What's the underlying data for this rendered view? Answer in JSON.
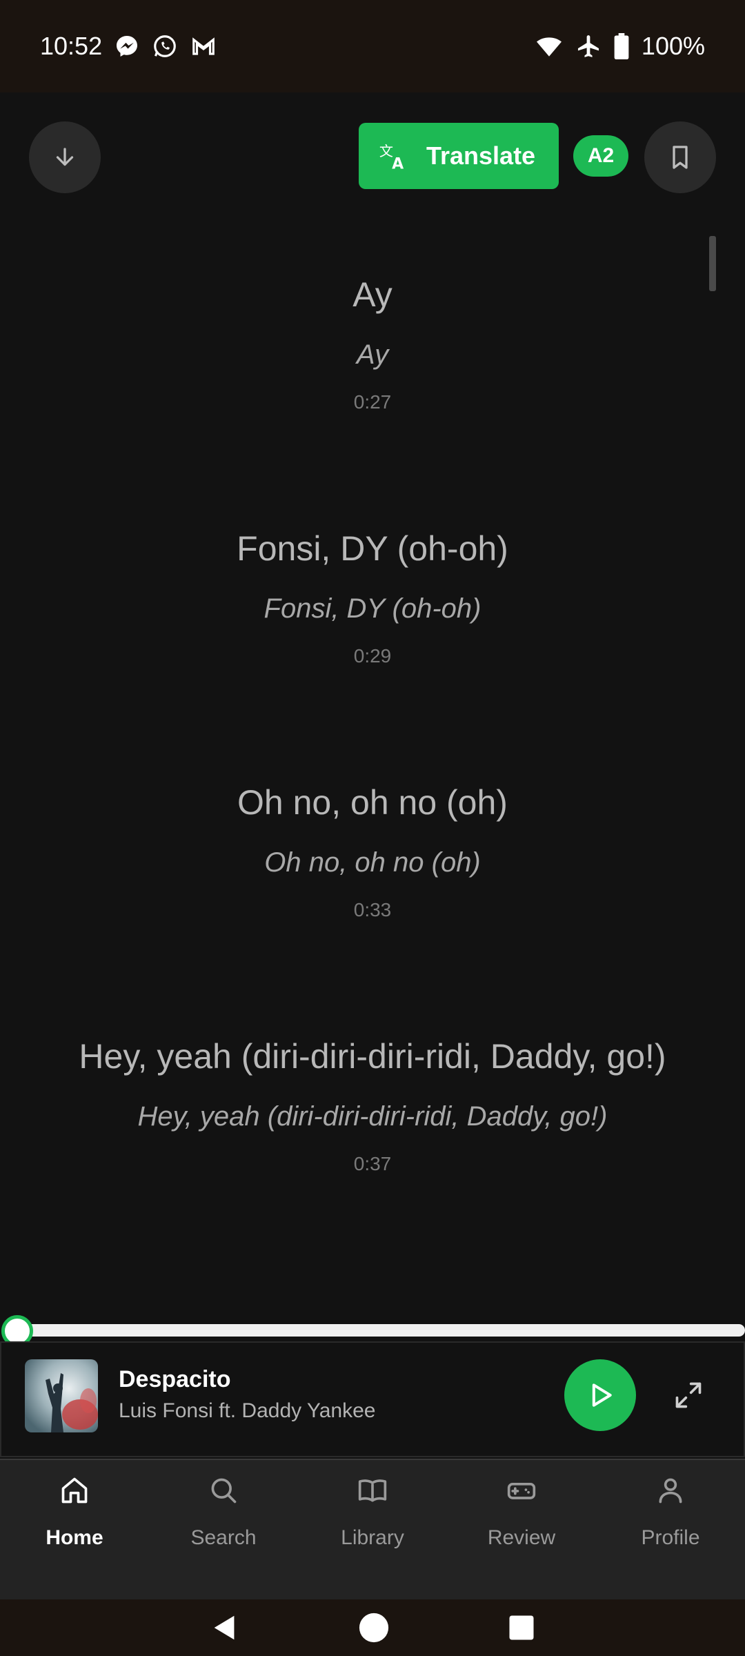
{
  "status_bar": {
    "time": "10:52",
    "battery": "100%",
    "left_icons": [
      "messenger-icon",
      "whatsapp-icon",
      "gmail-icon"
    ],
    "right_icons": [
      "wifi-icon",
      "airplane-icon",
      "battery-icon"
    ]
  },
  "header": {
    "translate_label": "Translate",
    "level_badge": "A2"
  },
  "lyrics": [
    {
      "original": "Ay",
      "translation": "Ay",
      "time": "0:27"
    },
    {
      "original": "Fonsi, DY (oh-oh)",
      "translation": "Fonsi, DY (oh-oh)",
      "time": "0:29"
    },
    {
      "original": "Oh no, oh no (oh)",
      "translation": "Oh no, oh no (oh)",
      "time": "0:33"
    },
    {
      "original": "Hey, yeah (diri-diri-diri-ridi, Daddy, go!)",
      "translation": "Hey, yeah (diri-diri-diri-ridi, Daddy, go!)",
      "time": "0:37"
    }
  ],
  "player": {
    "title": "Despacito",
    "artist": "Luis Fonsi ft. Daddy Yankee",
    "progress": 0
  },
  "nav": {
    "items": [
      {
        "label": "Home",
        "icon": "home-icon",
        "active": true
      },
      {
        "label": "Search",
        "icon": "search-icon",
        "active": false
      },
      {
        "label": "Library",
        "icon": "book-icon",
        "active": false
      },
      {
        "label": "Review",
        "icon": "gamepad-icon",
        "active": false
      },
      {
        "label": "Profile",
        "icon": "person-icon",
        "active": false
      }
    ]
  },
  "colors": {
    "accent": "#1db954",
    "background": "#121212",
    "status_bar": "#1b140f"
  }
}
